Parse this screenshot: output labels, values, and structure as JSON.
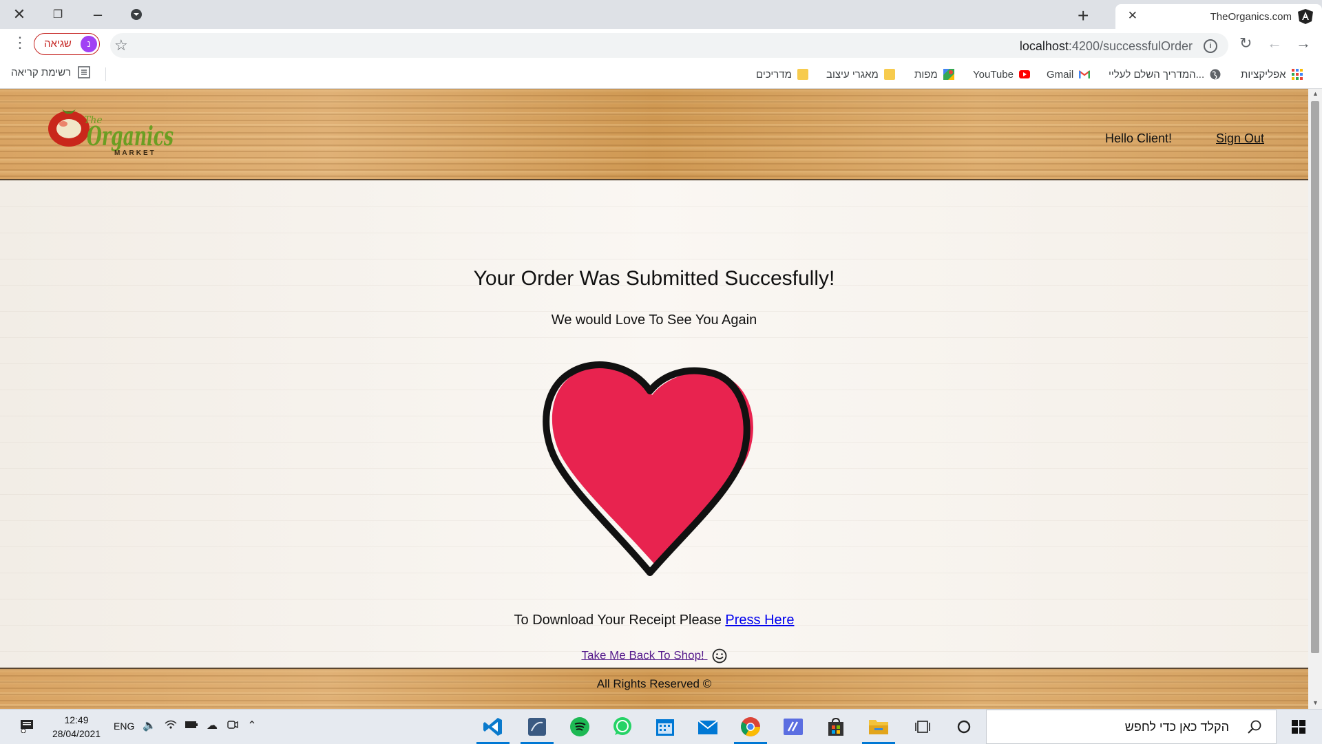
{
  "browser": {
    "tab_title": "TheOrganics.com",
    "url_host": "localhost",
    "url_path": ":4200/successfulOrder",
    "profile_label": "שגיאה",
    "profile_initial": "נ",
    "bookmarks": [
      {
        "label": "אפליקציות",
        "icon": "apps-grid-icon"
      },
      {
        "label": "המדריך השלם לעליי...",
        "icon": "globe-icon"
      },
      {
        "label": "Gmail",
        "icon": "gmail-icon"
      },
      {
        "label": "YouTube",
        "icon": "youtube-icon"
      },
      {
        "label": "מפות",
        "icon": "maps-icon"
      },
      {
        "label": "מאגרי עיצוב",
        "icon": "folder-icon"
      },
      {
        "label": "מדריכים",
        "icon": "folder-icon"
      }
    ],
    "reading_list": "רשימת קריאה"
  },
  "site": {
    "logo_text": {
      "the": "The",
      "organics": "Organics",
      "market": "MARKET"
    },
    "greeting": "Hello Client!",
    "sign_out": "Sign Out",
    "title": "Your Order Was Submitted Succesfully!",
    "subtitle": "We would Love To See You Again",
    "receipt_prefix": "To Download Your Receipt Please ",
    "receipt_link": "Press Here",
    "back_link": "Take Me Back To Shop!",
    "footer": "All Rights Reserved ©",
    "colors": {
      "heart": "#e8234f",
      "outline": "#111111",
      "link": "#0000ee",
      "visited": "#551a8b"
    }
  },
  "taskbar": {
    "time": "12:49",
    "date": "28/04/2021",
    "lang": "ENG",
    "search_placeholder": "הקלד כאן כדי לחפש",
    "apps": [
      "vscode-icon",
      "database-icon",
      "spotify-icon",
      "whatsapp-icon",
      "calendar-icon",
      "mail-icon",
      "chrome-icon",
      "editor-icon",
      "store-icon",
      "file-explorer-icon",
      "task-view-icon",
      "cortana-icon"
    ]
  }
}
